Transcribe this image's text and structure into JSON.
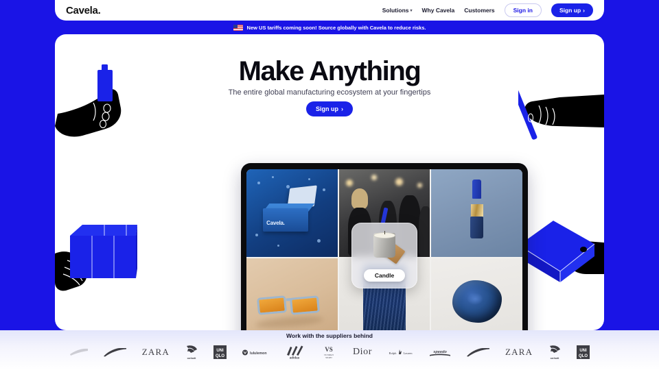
{
  "nav": {
    "brand": "Cavela.",
    "links": [
      {
        "label": "Solutions",
        "has_chevron": true,
        "icon": "chevron-down-icon"
      },
      {
        "label": "Why Cavela",
        "has_chevron": false
      },
      {
        "label": "Customers",
        "has_chevron": false
      }
    ],
    "sign_in": "Sign in",
    "sign_up": "Sign up",
    "sign_up_arrow": "›"
  },
  "banner": {
    "flag_icon": "us-flag-icon",
    "text": "New US tariffs coming soon! Source globally with Cavela to reduce risks."
  },
  "hero": {
    "title": "Make Anything",
    "subtitle": "The entire global manufacturing ecosystem at your fingertips",
    "cta_label": "Sign up",
    "cta_arrow": "›"
  },
  "decorations": [
    {
      "name": "hand-holding-bottle-illustration",
      "position": "top-left"
    },
    {
      "name": "hand-holding-pen-illustration",
      "position": "top-right"
    },
    {
      "name": "hand-holding-boxes-illustration",
      "position": "bottom-left"
    },
    {
      "name": "hand-holding-flat-box-illustration",
      "position": "bottom-right"
    }
  ],
  "showcase": {
    "device": "tablet",
    "tiles": [
      {
        "name": "gift-box-tile",
        "caption": "Cavela."
      },
      {
        "name": "event-people-tile",
        "caption": ""
      },
      {
        "name": "lipstick-tile",
        "caption": ""
      },
      {
        "name": "sunglasses-tile",
        "caption": ""
      },
      {
        "name": "scarf-tile",
        "caption": ""
      },
      {
        "name": "scrunchie-tile",
        "caption": ""
      }
    ],
    "popup": {
      "label": "Candle",
      "image": "candle-jar-with-tag"
    }
  },
  "suppliers": {
    "title": "Work with the suppliers behind",
    "logos": [
      {
        "name": "nike",
        "text": ""
      },
      {
        "name": "zara",
        "text": "ZARA"
      },
      {
        "name": "carhartt",
        "text": "carhartt"
      },
      {
        "name": "uniqlo",
        "text": "UNI QLO"
      },
      {
        "name": "lululemon",
        "text": "lululemon"
      },
      {
        "name": "adidas",
        "text": "adidas"
      },
      {
        "name": "victorias-secret",
        "text": "VICTORIA'S SECRET"
      },
      {
        "name": "dior",
        "text": "Dior"
      },
      {
        "name": "ralph-lauren",
        "text": "Ralph Lauren"
      },
      {
        "name": "speedo",
        "text": "speedo"
      },
      {
        "name": "nike",
        "text": ""
      },
      {
        "name": "zara",
        "text": "ZARA"
      },
      {
        "name": "carhartt",
        "text": "carhartt"
      },
      {
        "name": "uniqlo",
        "text": "UNI QLO"
      }
    ]
  },
  "colors": {
    "brand_blue": "#1a14e6",
    "button_blue": "#1a22e8",
    "text_dark": "#0a0a12",
    "panel_white": "#ffffff"
  }
}
